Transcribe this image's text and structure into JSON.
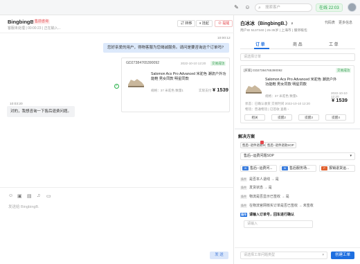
{
  "top": {
    "search_placeholder": "搜索客户",
    "status": "在线 22:03"
  },
  "chat": {
    "name": "BingbingB.",
    "tag": "售前咨询",
    "sub": "客服未处理 | 00:00:23 | 正在输入...",
    "btn_transfer": "转移",
    "btn_hangup": "挂起",
    "btn_remind": "提醒",
    "time1": "10:00:12",
    "agent_msg": "您好亲爱的用户，得物客服为您竭诚服务。请问是要咨询这个订单吗?",
    "order_no": "GD27384765390092",
    "order_date": "2022-10-10 12:20",
    "order_status": "交易成功",
    "product": "Salomon Acs Pro Advanced 米驼色 潮流户外功能鞋 男女同款 明星同款",
    "spec": "规格：37 米驼色  数量1",
    "paid_label": "实际支付",
    "price": "¥ 1539",
    "time2": "10:03:20",
    "user_msg": "对的，我想咨询一下售后退费问题。",
    "placeholder": "发送给 BingbingB.",
    "send": "发 送"
  },
  "customer": {
    "name": "白冰冰（BingbingB.）♀",
    "info": "用户ID 5137340 | 25-35岁 | 上海市 | 服饰鞋包",
    "link1": "代码表",
    "link2": "更多信息",
    "tabs": [
      "订 单",
      "商 品",
      "工 单"
    ],
    "order_select": "请选择订单",
    "order_header": "[买家] GD27384765390092",
    "order_status": "交易成功",
    "product": "Salomon Acs Pro Advanced 米驼色 潮流户外功能鞋 男女同款 明星同款",
    "date": "2022-10-10 12:20",
    "spec": "规格：37 米驼色 数量1",
    "price": "¥ 1539",
    "meta1": "状态：已确认收货  交易时间 2022-10-10 12:20",
    "meta2": "物流：普通物流 | 已签收  查看 ›",
    "actions": [
      "相关",
      "提醒2",
      "提醒3",
      "提醒4"
    ]
  },
  "solution": {
    "title": "解决方案",
    "chips": [
      "售后--退件退款SOP",
      "售后--退件退款SOP"
    ],
    "select": "售后--运费问题SOP",
    "files": [
      "售后--运费问...",
      "售后服务场...",
      "报销退货运..."
    ],
    "steps": [
      "是否本人退线 → 是",
      "发货状态 → 是",
      "物流是否显示已签收 → 是",
      "在物流官网核实订单是否已签收 → 未签收"
    ],
    "current_step": "请输入订单号，回车进行确认",
    "input_placeholder": "请输入",
    "ticket_placeholder": "请选择工单问题类型",
    "create": "创建工单"
  }
}
